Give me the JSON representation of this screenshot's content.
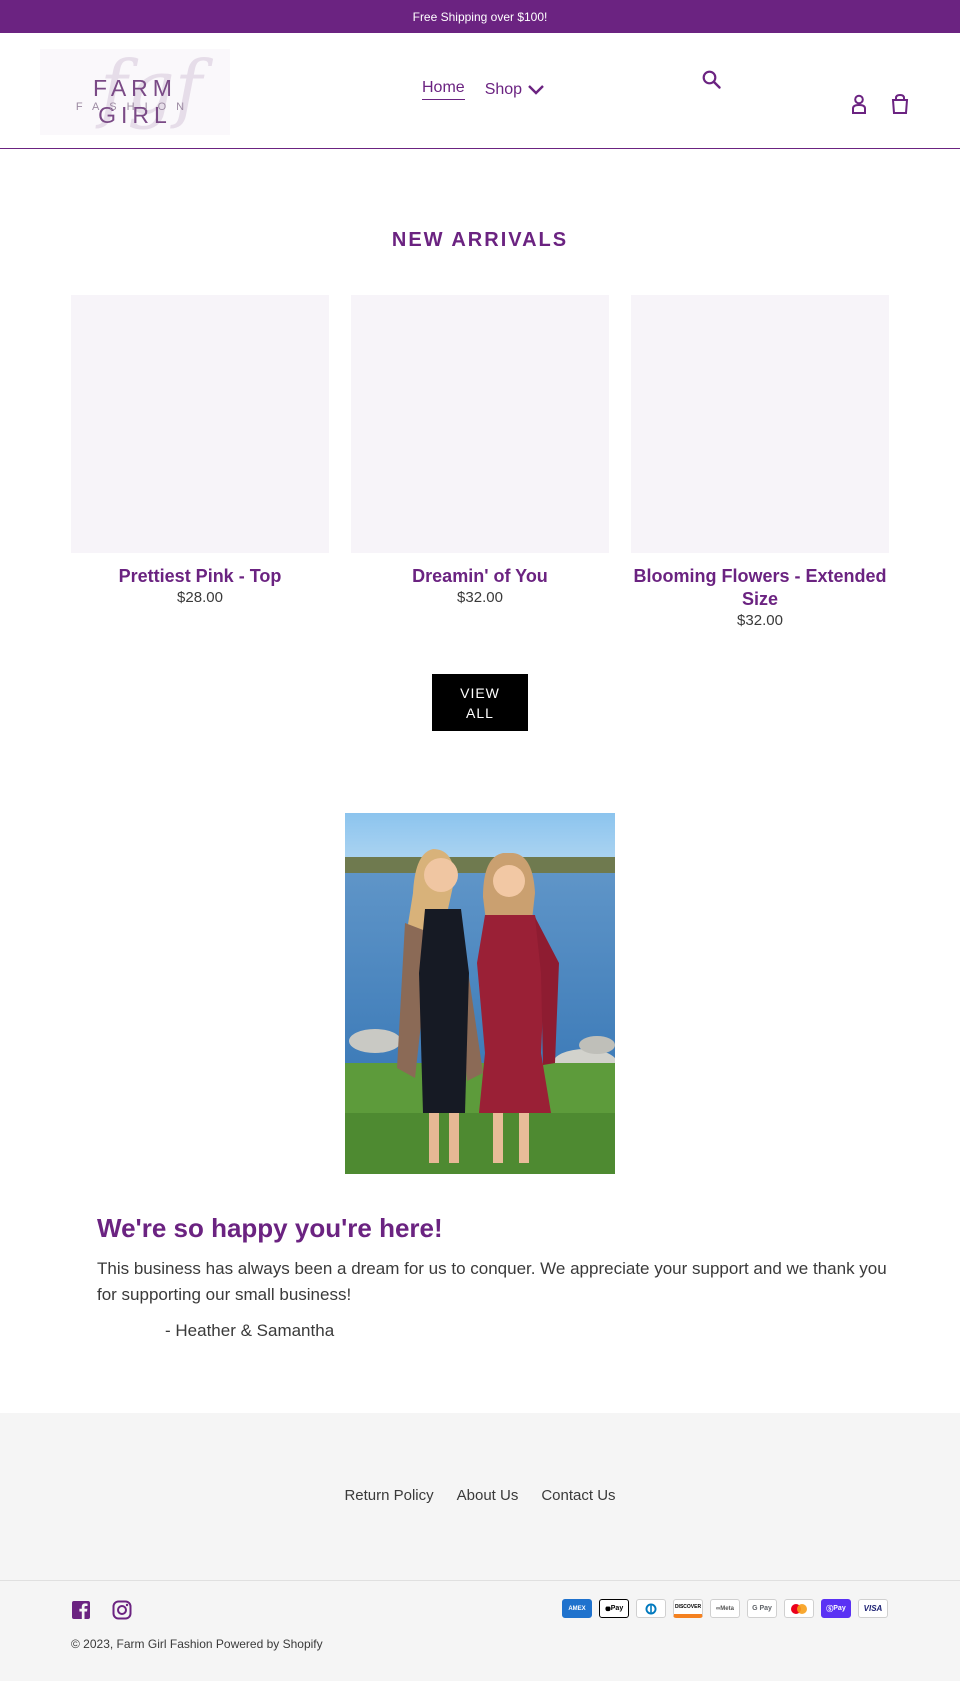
{
  "announcement": "Free Shipping over $100!",
  "header": {
    "logo": {
      "main": "FARM GIRL",
      "sub": "FASHION",
      "monogram": "fgf"
    },
    "nav": {
      "home": "Home",
      "shop": "Shop"
    },
    "icons": {
      "search": "search-icon",
      "account": "account-icon",
      "cart": "cart-icon",
      "shop_chevron": "chevron-down-icon"
    }
  },
  "collection": {
    "title": "NEW ARRIVALS",
    "products": [
      {
        "name": "Prettiest Pink - Top",
        "price": "$28.00"
      },
      {
        "name": "Dreamin' of You",
        "price": "$32.00"
      },
      {
        "name": "Blooming Flowers - Extended Size",
        "price": "$32.00"
      }
    ],
    "view_all": "VIEW ALL"
  },
  "welcome": {
    "heading": "We're so happy you're here!",
    "body": "This business has always been a dream for us to conquer. We appreciate your support and we thank you for supporting our small business!",
    "signature": "- Heather & Samantha"
  },
  "footer": {
    "links": [
      "Return Policy",
      "About Us",
      "Contact Us"
    ],
    "social": [
      "facebook-icon",
      "instagram-icon"
    ],
    "payments": [
      "AMEX",
      "Pay",
      "Diners",
      "DISCOVER",
      "Meta",
      "G Pay",
      "Mastercard",
      "Pay",
      "VISA"
    ],
    "copyright": "© 2023, Farm Girl Fashion Powered by Shopify"
  },
  "colors": {
    "brand": "#6b2381",
    "text": "#3a3a3a",
    "footer_bg": "#f5f5f5",
    "button": "#000000"
  }
}
